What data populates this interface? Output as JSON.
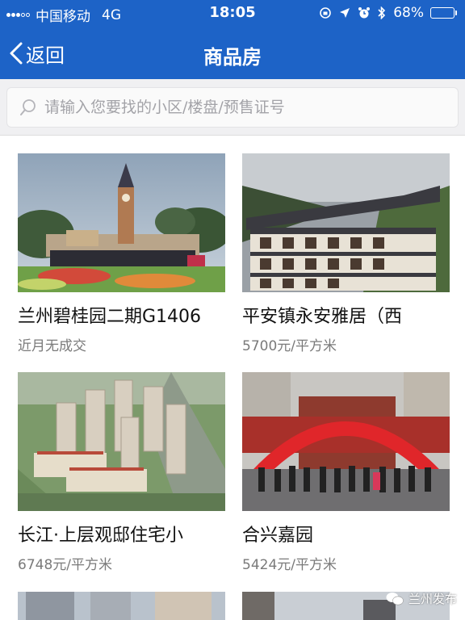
{
  "status_bar": {
    "carrier": "中国移动",
    "network": "4G",
    "time": "18:05",
    "battery": "68%",
    "battery_level": 0.68,
    "icons": [
      "orientation-lock-icon",
      "location-icon",
      "alarm-icon",
      "bluetooth-icon",
      "battery-icon"
    ]
  },
  "nav": {
    "back_label": "返回",
    "title": "商品房"
  },
  "search": {
    "placeholder": "请输入您要找的小区/楼盘/预售证号"
  },
  "listings": [
    {
      "name": "兰州碧桂园二期G1406",
      "price": "近月无成交"
    },
    {
      "name": "平安镇永安雅居（西",
      "price": "5700元/平方米"
    },
    {
      "name": "长江·上层观邸住宅小",
      "price": "6748元/平方米"
    },
    {
      "name": "合兴嘉园",
      "price": "5424元/平方米"
    }
  ],
  "watermark": "兰州发布",
  "colors": {
    "header_blue": "#1d63c7",
    "search_bg": "#f0f0f2",
    "price_gray": "#7a7a7a"
  }
}
